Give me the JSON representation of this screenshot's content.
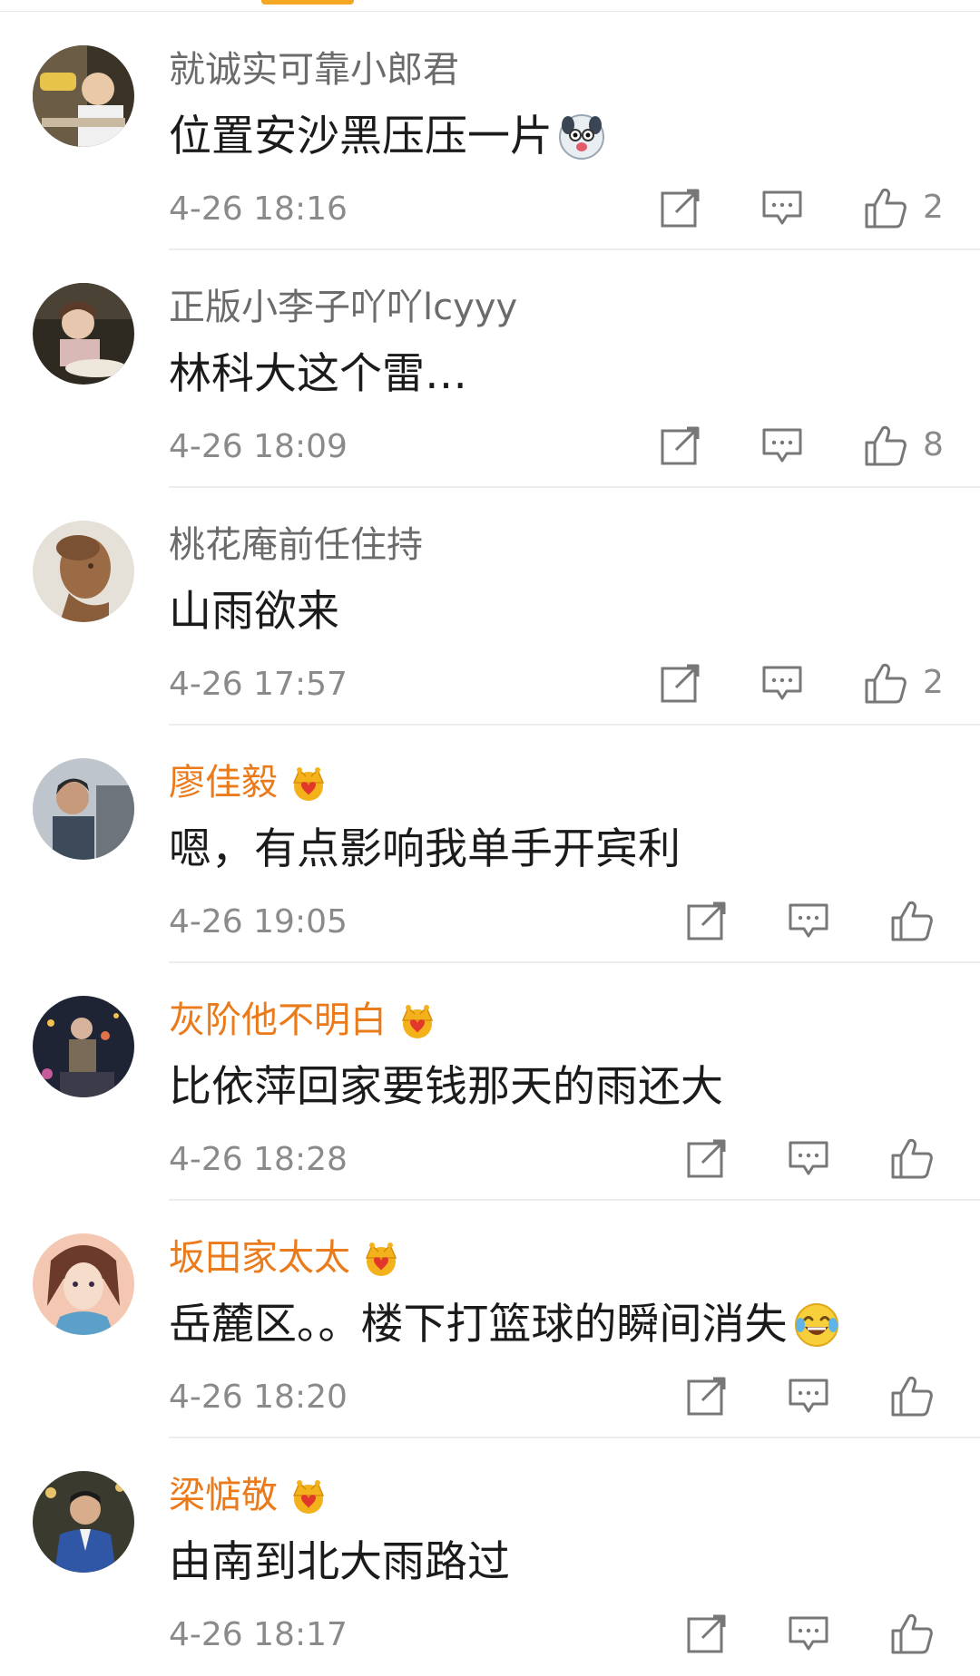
{
  "comments": [
    {
      "author": "就诚实可靠小郎君",
      "vip": false,
      "text": "位置安沙黑压压一片",
      "emoji": "dog-face-emoji",
      "time": "4-26 18:16",
      "likes": "2"
    },
    {
      "author": "正版小李子吖吖lcyyy",
      "vip": false,
      "text": "林科大这个雷…",
      "emoji": "",
      "time": "4-26 18:09",
      "likes": "8"
    },
    {
      "author": "桃花庵前任住持",
      "vip": false,
      "text": "山雨欲来",
      "emoji": "",
      "time": "4-26 17:57",
      "likes": "2"
    },
    {
      "author": "廖佳毅",
      "vip": true,
      "text": "嗯，有点影响我单手开宾利",
      "emoji": "",
      "time": "4-26 19:05",
      "likes": ""
    },
    {
      "author": "灰阶他不明白",
      "vip": true,
      "text": "比依萍回家要钱那天的雨还大",
      "emoji": "",
      "time": "4-26 18:28",
      "likes": ""
    },
    {
      "author": "坂田家太太",
      "vip": true,
      "text": "岳麓区。。楼下打篮球的瞬间消失",
      "emoji": "tears-of-joy-emoji",
      "time": "4-26 18:20",
      "likes": ""
    },
    {
      "author": "梁惦敬",
      "vip": true,
      "text": "由南到北大雨路过",
      "emoji": "",
      "time": "4-26 18:17",
      "likes": ""
    }
  ],
  "icons": {
    "repost": "repost-icon",
    "reply": "comment-icon",
    "like": "thumbs-up-icon",
    "vip": "crown-icon"
  },
  "colors": {
    "vip_name": "#eb7a1b",
    "plain_name": "#6b6b6b",
    "meta_gray": "#8a8a8a",
    "tab_accent": "#f5a623"
  }
}
